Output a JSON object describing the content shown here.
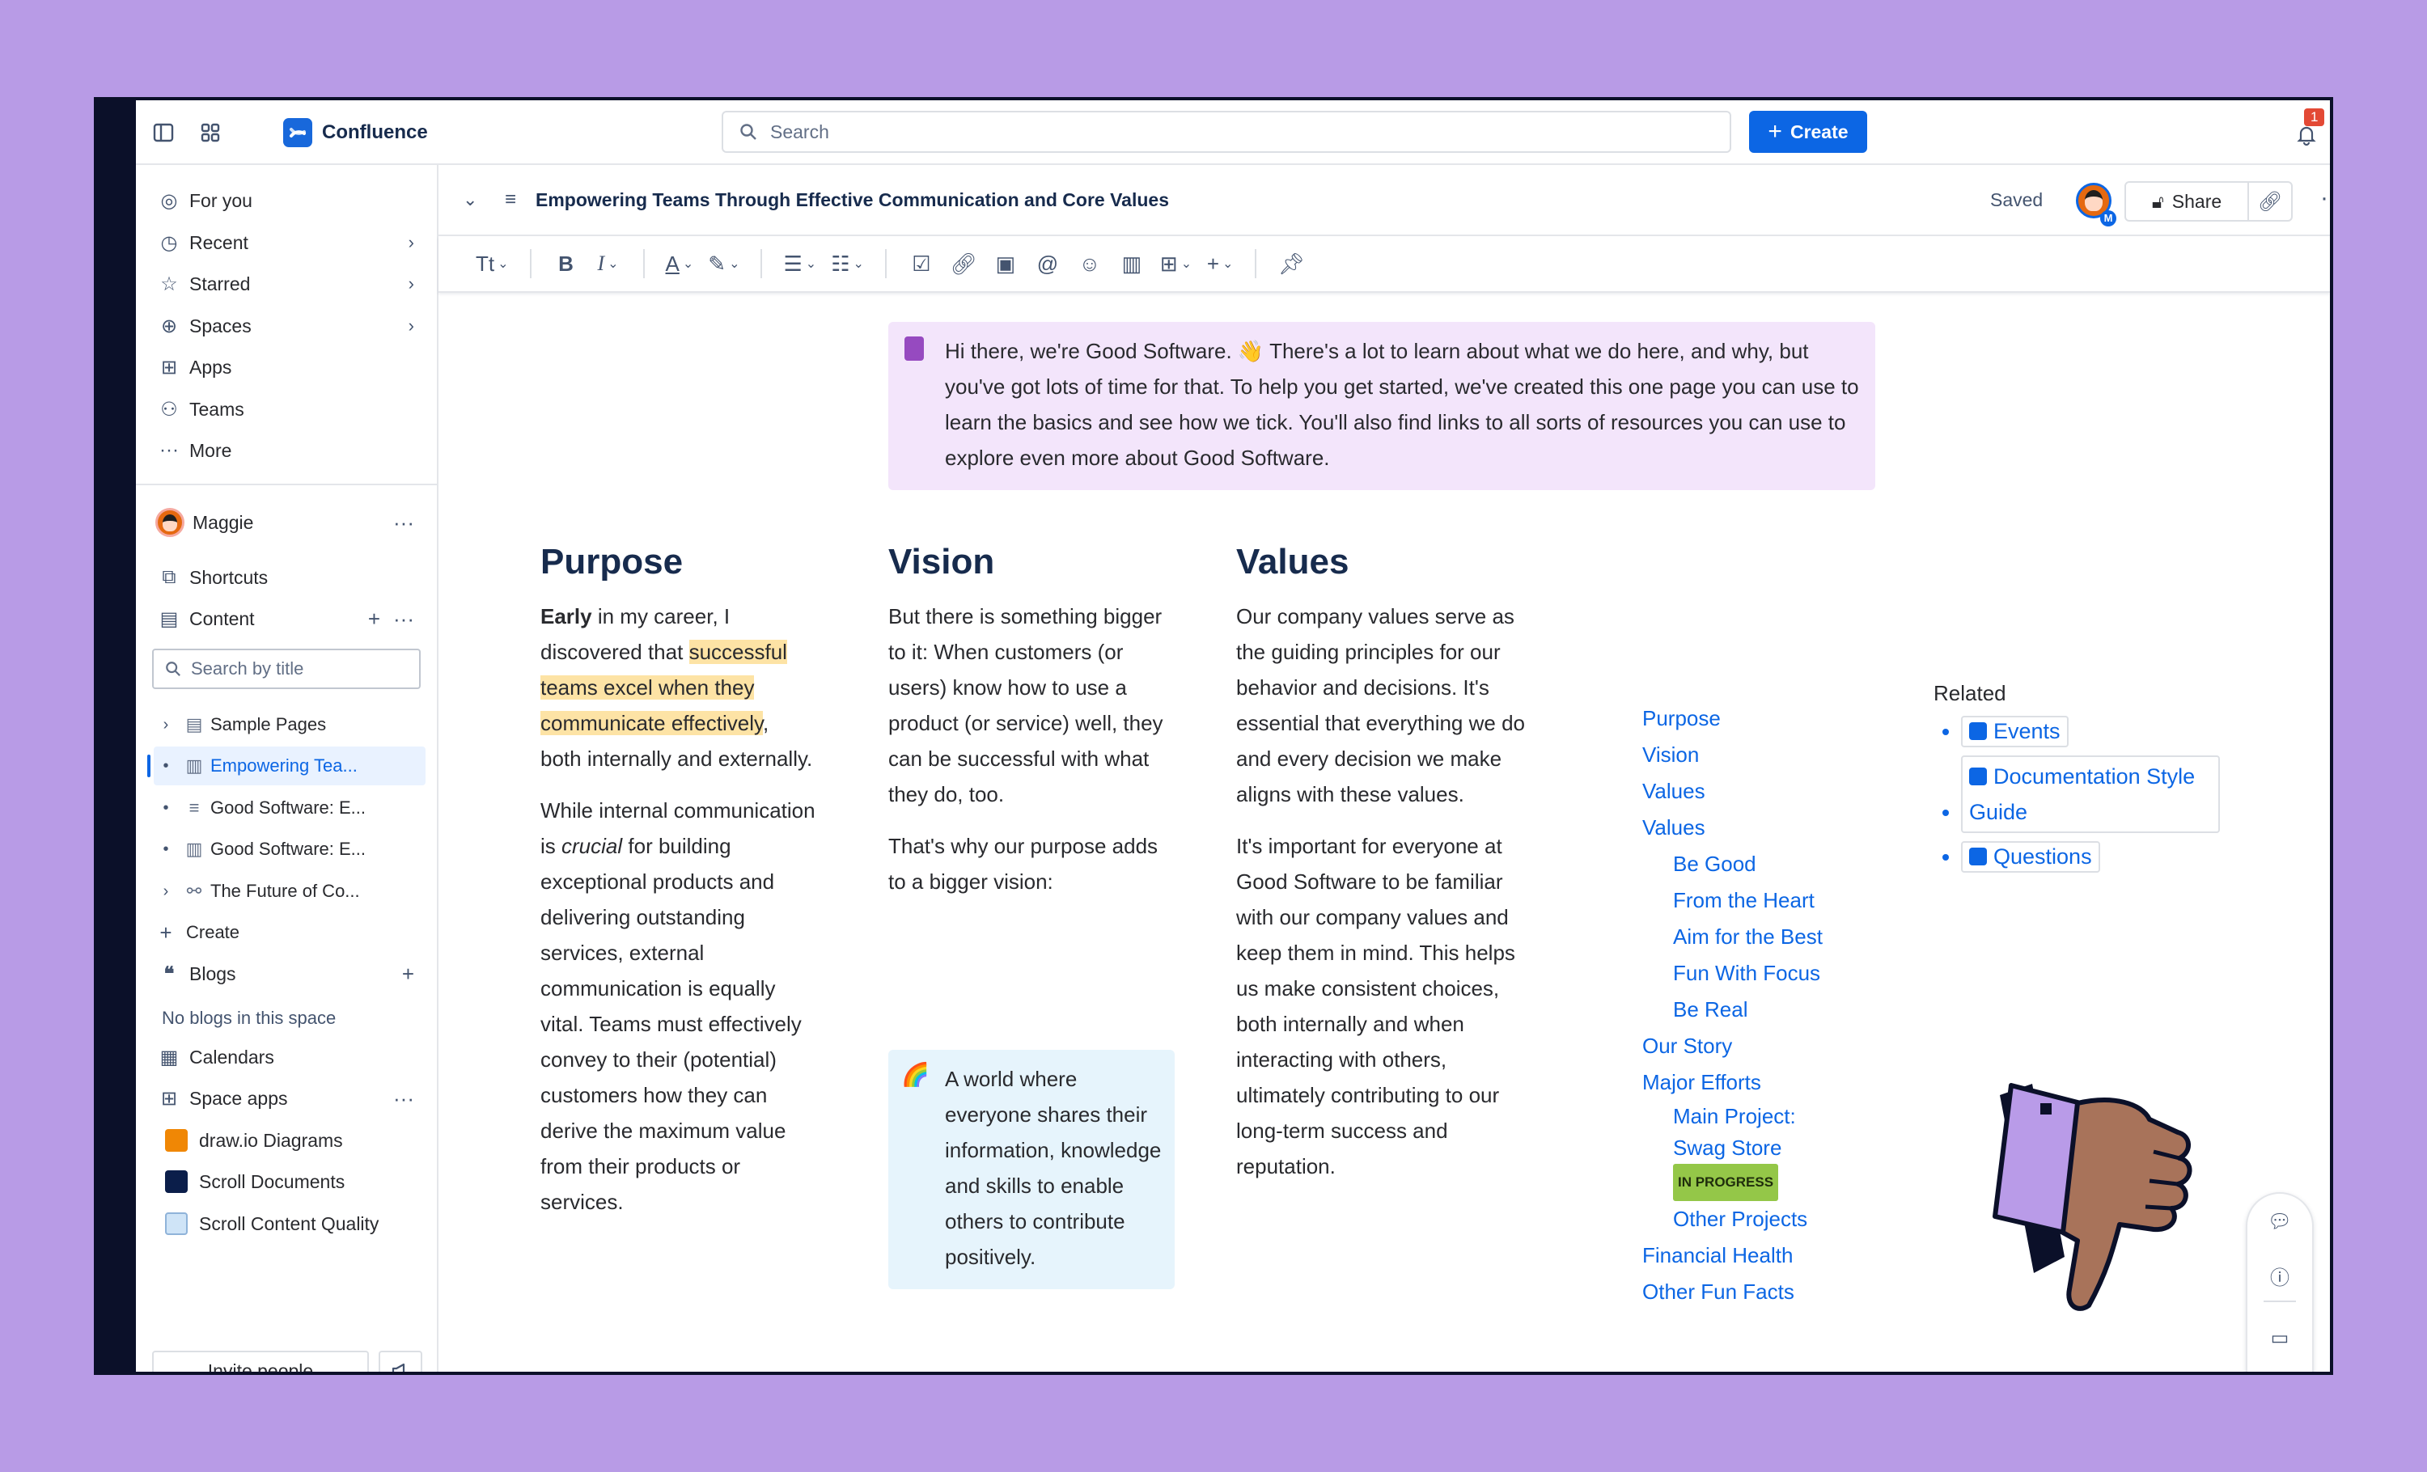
{
  "app": {
    "name": "Confluence"
  },
  "topnav": {
    "search_placeholder": "Search",
    "create_label": "Create",
    "notification_count": "1"
  },
  "sidebar": {
    "nav": [
      {
        "label": "For you",
        "icon": "user-circle-icon"
      },
      {
        "label": "Recent",
        "icon": "clock-icon"
      },
      {
        "label": "Starred",
        "icon": "star-icon"
      },
      {
        "label": "Spaces",
        "icon": "globe-icon"
      },
      {
        "label": "Apps",
        "icon": "apps-icon"
      },
      {
        "label": "Teams",
        "icon": "people-icon"
      },
      {
        "label": "More",
        "icon": "ellipsis-icon"
      }
    ],
    "space_name": "Maggie",
    "shortcuts_label": "Shortcuts",
    "content_label": "Content",
    "search_placeholder": "Search by title",
    "tree": [
      {
        "label": "Sample Pages",
        "icon": "page-icon"
      },
      {
        "label": "Empowering Tea...",
        "icon": "building-icon"
      },
      {
        "label": "Good Software: E...",
        "icon": "list-icon"
      },
      {
        "label": "Good Software: E...",
        "icon": "building-icon"
      },
      {
        "label": "The Future of Co...",
        "icon": "whiteboard-icon"
      }
    ],
    "create_label": "Create",
    "blogs_label": "Blogs",
    "no_blogs": "No blogs in this space",
    "calendars_label": "Calendars",
    "space_apps_label": "Space apps",
    "apps": [
      {
        "label": "draw.io Diagrams"
      },
      {
        "label": "Scroll Documents"
      },
      {
        "label": "Scroll Content Quality"
      }
    ],
    "invite_label": "Invite people"
  },
  "page": {
    "title": "Empowering Teams Through Effective Communication and Core Values",
    "saved_label": "Saved",
    "share_label": "Share",
    "collaborator_badge": "M"
  },
  "toolbar": {
    "text_style": "Tt"
  },
  "intro": {
    "emoji": "👋",
    "text_before_emoji": "Hi there, we're Good Software.",
    "text_after_emoji": "There's a lot to learn about what we do here, and why, but you've got lots of time for that. To help you get started, we've created this one page you can use to learn the basics and see how we tick. You'll also find links to all sorts of resources you can use to explore even more about Good Software."
  },
  "purpose": {
    "heading": "Purpose",
    "p1_bold": "Early",
    "p1_a": "in my career, I discovered that",
    "p1_highlight": "successful teams excel when they communicate effectively",
    "p1_b": ", both internally and externally.",
    "p2_a": "While internal communication is",
    "p2_italic": "crucial",
    "p2_b": "for building exceptional products and delivering outstanding services, external communication is equally vital. Teams must effectively convey to their (potential) customers how they can derive the maximum value from their products or services."
  },
  "vision": {
    "heading": "Vision",
    "p1": "But there is something bigger to it: When customers (or users) know how to use a product (or service) well, they can be successful with what they do, too.",
    "p2": "That's why our purpose adds to a bigger vision:",
    "panel_emoji": "🌈",
    "panel_text": "A world where everyone shares their information, knowledge and skills to enable others to contribute positively."
  },
  "values": {
    "heading": "Values",
    "p1": "Our company values serve as the guiding principles for our behavior and decisions. It's essential that everything we do and every decision we make aligns with these values.",
    "p2": "It's important for everyone at Good Software to be familiar with our company values and keep them in mind. This helps us make consistent choices, both internally and when interacting with others, ultimately contributing to our long-term success and reputation."
  },
  "toc": {
    "items": [
      "Purpose",
      "Vision",
      "Values",
      "Values"
    ],
    "sub_values": [
      "Be Good",
      "From the Heart",
      "Aim for the Best",
      "Fun With Focus",
      "Be Real"
    ],
    "our_story": "Our Story",
    "major_efforts": "Major Efforts",
    "main_project": "Main Project: Swag Store",
    "status": "IN PROGRESS",
    "other_projects": "Other Projects",
    "financial_health": "Financial Health",
    "other_fun_facts": "Other Fun Facts"
  },
  "related": {
    "heading": "Related",
    "items": [
      "Events",
      "Documentation Style Guide",
      "Questions"
    ]
  },
  "colors": {
    "accent": "#0c66e4",
    "background": "#b89be6",
    "highlight": "#fde3a5",
    "intro_panel": "#f3e5fb",
    "vision_panel": "#e6f4fc",
    "status_lozenge": "#94c748"
  }
}
